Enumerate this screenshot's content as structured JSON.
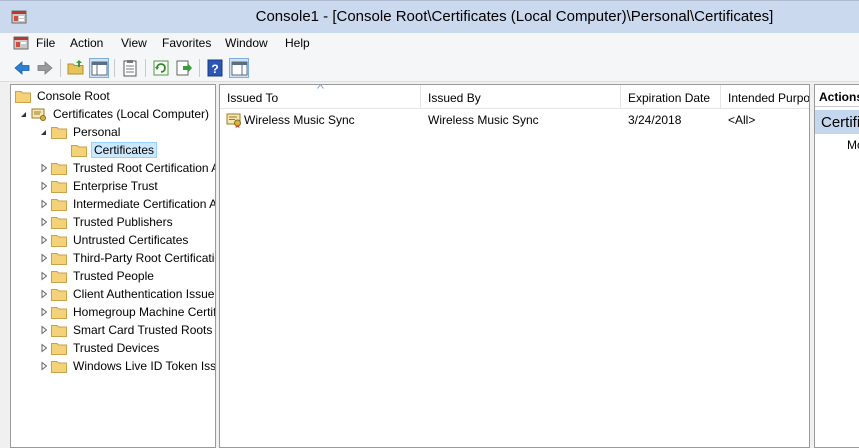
{
  "window": {
    "title": "Console1 - [Console Root\\Certificates (Local Computer)\\Personal\\Certificates]"
  },
  "menu": [
    "File",
    "Action",
    "View",
    "Favorites",
    "Window",
    "Help"
  ],
  "toolbar": {
    "icons": [
      "back-arrow-icon",
      "forward-arrow-icon",
      "up-folder-icon",
      "show-hide-tree-icon",
      "clipboard-icon",
      "refresh-icon",
      "export-icon",
      "help-icon",
      "show-action-pane-icon"
    ]
  },
  "tree": {
    "root": "Console Root",
    "snapin": "Certificates (Local Computer)",
    "personal": "Personal",
    "certificates": "Certificates",
    "stores": [
      "Trusted Root Certification Authorities",
      "Enterprise Trust",
      "Intermediate Certification Authorities",
      "Trusted Publishers",
      "Untrusted Certificates",
      "Third-Party Root Certification Authorities",
      "Trusted People",
      "Client Authentication Issuers",
      "Homegroup Machine Certificates",
      "Smart Card Trusted Roots",
      "Trusted Devices",
      "Windows Live ID Token Issuer"
    ]
  },
  "list": {
    "columns": [
      "Issued To",
      "Issued By",
      "Expiration Date",
      "Intended Purposes"
    ],
    "rows": [
      {
        "issued_to": "Wireless Music Sync",
        "issued_by": "Wireless Music Sync",
        "expiration": "3/24/2018",
        "purposes": "<All>"
      }
    ]
  },
  "actions": {
    "header": "Actions",
    "section": "Certificates",
    "more": "More Actions"
  }
}
